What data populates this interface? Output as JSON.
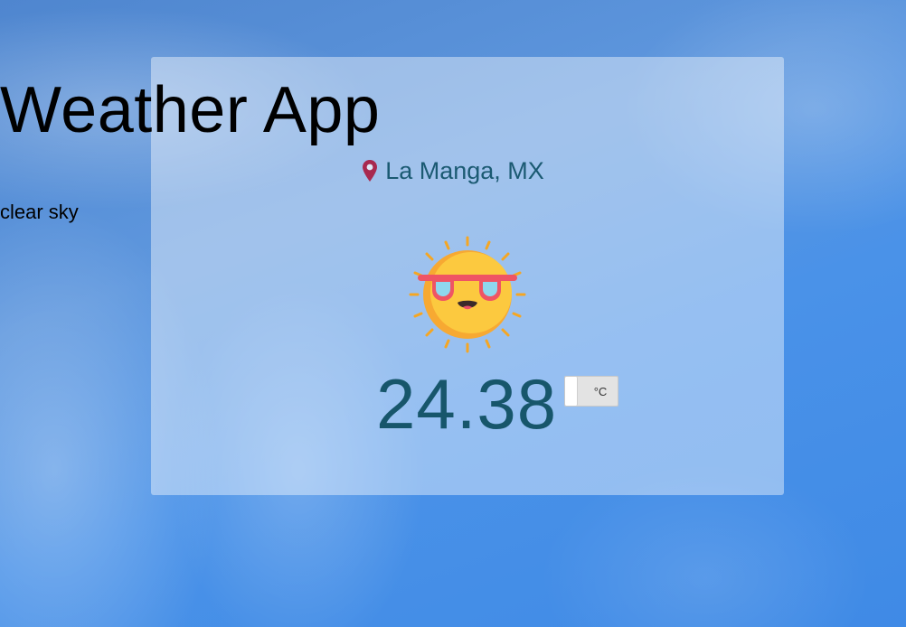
{
  "app": {
    "title": "Weather App"
  },
  "location": {
    "icon": "map-pin-icon",
    "text": "La Manga, MX",
    "pin_color": "#a8294f"
  },
  "weather": {
    "description": "clear sky",
    "icon": "sun-with-sunglasses-icon",
    "temperature": "24.38"
  },
  "unit_toggle": {
    "label": "°C"
  },
  "colors": {
    "temperature": "#17566b",
    "location_text": "#1b5a72"
  }
}
